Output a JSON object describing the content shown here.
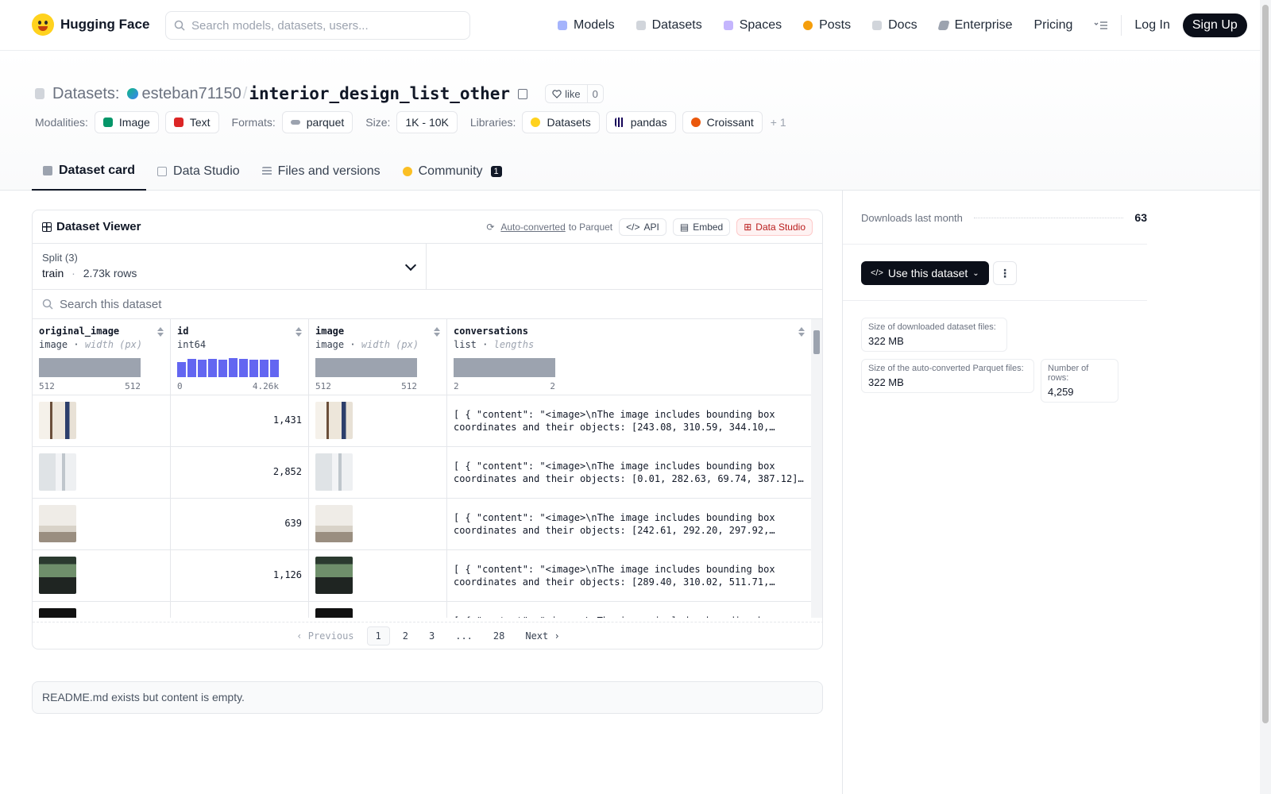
{
  "header": {
    "brand": "Hugging Face",
    "search_placeholder": "Search models, datasets, users...",
    "nav": [
      "Models",
      "Datasets",
      "Spaces",
      "Posts",
      "Docs",
      "Enterprise",
      "Pricing"
    ],
    "login": "Log In",
    "signup": "Sign Up"
  },
  "repo": {
    "section": "Datasets:",
    "owner": "esteban71150",
    "name": "interior_design_list_other",
    "like_label": "like",
    "like_count": "0"
  },
  "tags": {
    "modalities_label": "Modalities:",
    "modalities": [
      "Image",
      "Text"
    ],
    "formats_label": "Formats:",
    "format": "parquet",
    "size_label": "Size:",
    "size": "1K - 10K",
    "libraries_label": "Libraries:",
    "libraries": [
      "Datasets",
      "pandas",
      "Croissant"
    ],
    "more": "+ 1"
  },
  "tabs": {
    "card": "Dataset card",
    "studio": "Data Studio",
    "files": "Files and versions",
    "community": "Community",
    "community_count": "1"
  },
  "viewer": {
    "title": "Dataset Viewer",
    "auto_converted": "Auto-converted",
    "to_parquet": "to Parquet",
    "api": "API",
    "embed": "Embed",
    "studio": "Data Studio",
    "split_label": "Split (3)",
    "split_value": "train",
    "split_rows": "2.73k rows",
    "search_placeholder": "Search this dataset",
    "columns": [
      {
        "name": "original_image",
        "type": "image",
        "stat": "width (px)",
        "min": "512",
        "max": "512"
      },
      {
        "name": "id",
        "type": "int64",
        "stat": "",
        "min": "0",
        "max": "4.26k"
      },
      {
        "name": "image",
        "type": "image",
        "stat": "width (px)",
        "min": "512",
        "max": "512"
      },
      {
        "name": "conversations",
        "type": "list",
        "stat": "lengths",
        "min": "2",
        "max": "2"
      }
    ],
    "id_histogram": [
      0.78,
      0.95,
      0.92,
      0.94,
      0.93,
      0.98,
      0.96,
      0.9,
      0.93,
      0.91
    ],
    "rows": [
      {
        "id": "1,431",
        "conv": "[ { \"content\": \"<image>\\nThe image includes bounding box\ncoordinates and their objects: [243.08, 310.59, 344.10,…"
      },
      {
        "id": "2,852",
        "conv": "[ { \"content\": \"<image>\\nThe image includes bounding box\ncoordinates and their objects: [0.01, 282.63, 69.74, 387.12]…"
      },
      {
        "id": "639",
        "conv": "[ { \"content\": \"<image>\\nThe image includes bounding box\ncoordinates and their objects: [242.61, 292.20, 297.92,…"
      },
      {
        "id": "1,126",
        "conv": "[ { \"content\": \"<image>\\nThe image includes bounding box\ncoordinates and their objects: [289.40, 310.02, 511.71,…"
      },
      {
        "id": "",
        "conv": "[ { \"content\": \"<image>\\nThe image includes bounding box"
      }
    ],
    "pager": {
      "prev": "Previous",
      "pages": [
        "1",
        "2",
        "3",
        "...",
        "28"
      ],
      "next": "Next"
    }
  },
  "readme": "README.md exists but content is empty.",
  "sidebar": {
    "downloads_label": "Downloads last month",
    "downloads": "63",
    "use_dataset": "Use this dataset",
    "size_dl_label": "Size of downloaded dataset files:",
    "size_dl": "322 MB",
    "size_parquet_label": "Size of the auto-converted Parquet files:",
    "size_parquet": "322 MB",
    "rows_label": "Number of rows:",
    "rows": "4,259"
  }
}
